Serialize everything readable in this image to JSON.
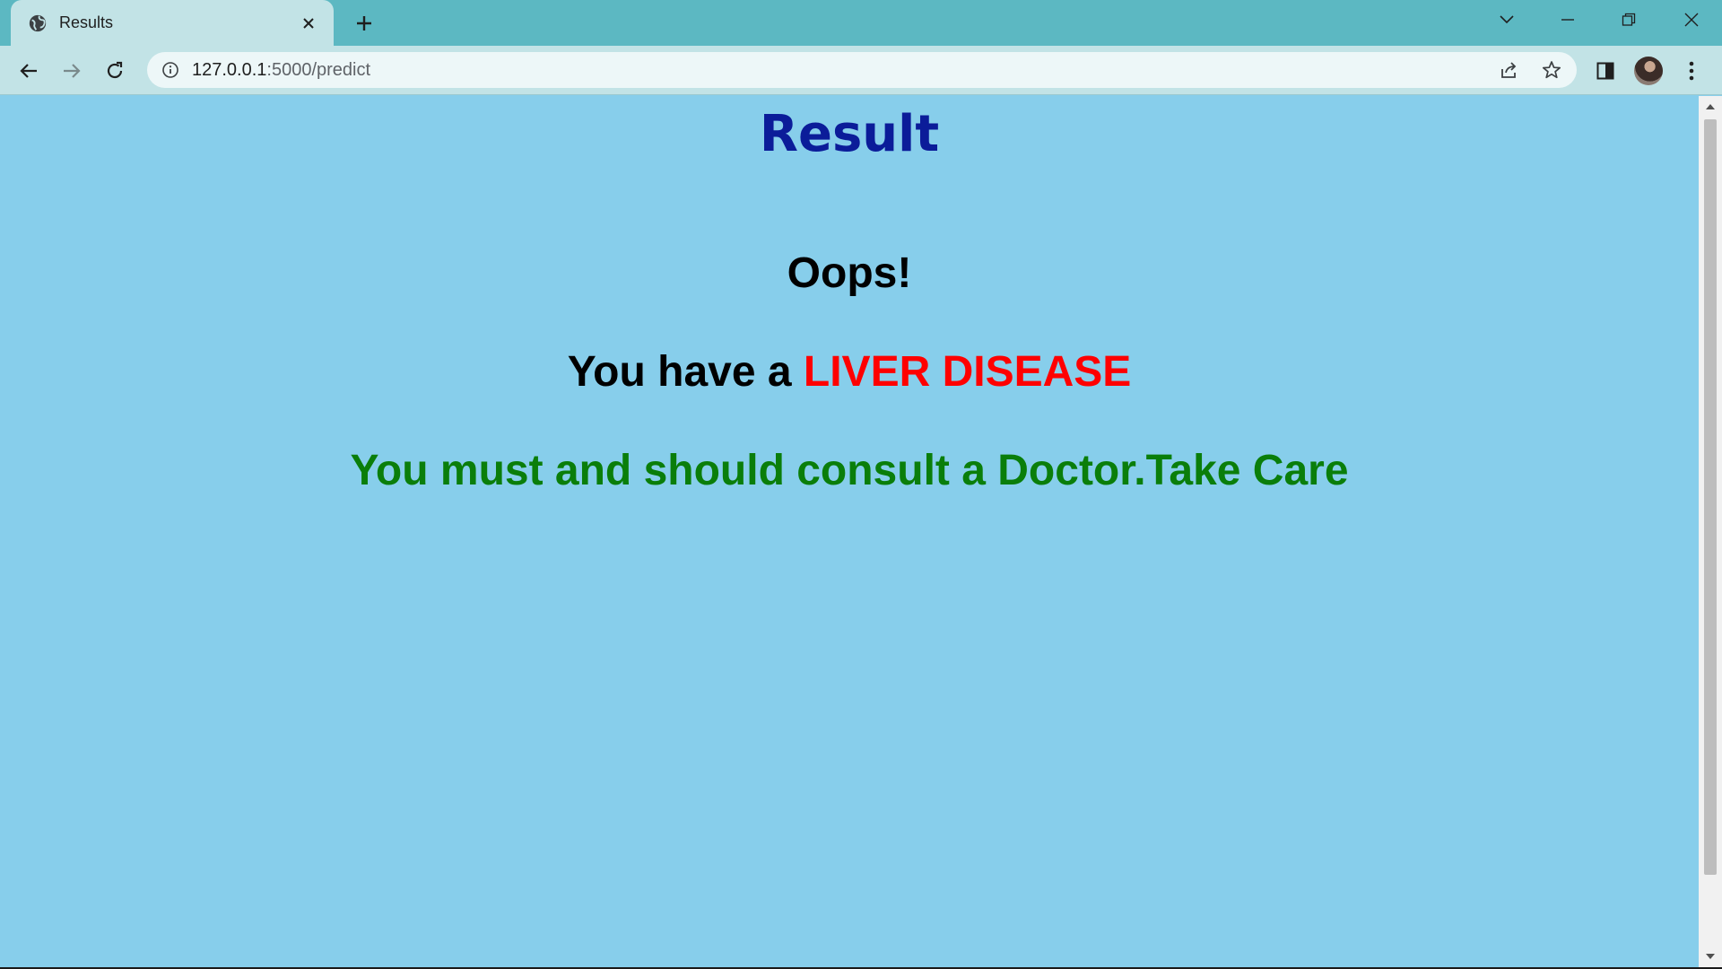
{
  "browser": {
    "tab": {
      "title": "Results",
      "favicon": "globe-icon"
    },
    "address": {
      "host": "127.0.0.1",
      "path": ":5000/predict"
    }
  },
  "page": {
    "title": "Result",
    "oops": "Oops!",
    "diagnosis_prefix": "You have a ",
    "diagnosis_highlight": "LIVER DISEASE",
    "advice": "You must and should consult a Doctor.Take Care"
  },
  "colors": {
    "background": "#87CEEB",
    "title": "#0B1C99",
    "highlight": "#FF0000",
    "advice": "#0A7E0A",
    "tab_strip": "#5CB8C2",
    "toolbar": "#C2E3E6"
  }
}
